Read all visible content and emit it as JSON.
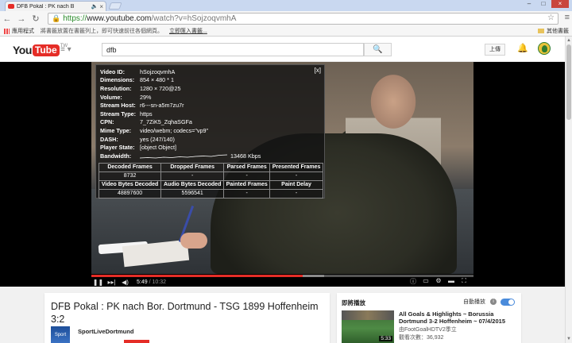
{
  "browser": {
    "tab_title": "DFB Pokal : PK nach B",
    "url_scheme": "https://",
    "url_host": "www.youtube.com",
    "url_path": "/watch?v=hSojzoqvmhA",
    "bookmarks": {
      "apps": "應用程式",
      "hint": "將書籤放置在書籤列上，即可快速前往各個網頁。",
      "import": "立即匯入書籤...",
      "other": "其他書籤"
    }
  },
  "youtube": {
    "logo_you": "You",
    "logo_tube": "Tube",
    "region": "TW",
    "search_value": "dfb",
    "upload_label": "上傳"
  },
  "stats": {
    "rows": [
      {
        "k": "Video ID:",
        "v": "hSojzoqvmhA"
      },
      {
        "k": "Dimensions:",
        "v": "854 × 480 * 1"
      },
      {
        "k": "Resolution:",
        "v": "1280 × 720@25"
      },
      {
        "k": "Volume:",
        "v": "29%"
      },
      {
        "k": "Stream Host:",
        "v": "r6---sn-a5m7zu7r"
      },
      {
        "k": "Stream Type:",
        "v": "https"
      },
      {
        "k": "CPN:",
        "v": "7_7ZiK5_ZqhaSGFa"
      },
      {
        "k": "Mime Type:",
        "v": "video/webm; codecs=\"vp9\""
      },
      {
        "k": "DASH:",
        "v": "yes (247/140)"
      },
      {
        "k": "Player State:",
        "v": "[object Object]"
      }
    ],
    "bandwidth_label": "Bandwidth:",
    "bandwidth_value": "13468 Kbps",
    "table_headers1": [
      "Decoded Frames",
      "Dropped Frames",
      "Parsed Frames",
      "Presented Frames"
    ],
    "table_values1": [
      "8732",
      "-",
      "-",
      "-"
    ],
    "table_headers2": [
      "Video Bytes Decoded",
      "Audio Bytes Decoded",
      "Painted Frames",
      "Paint Delay"
    ],
    "table_values2": [
      "48897600",
      "5596541",
      "-",
      "-"
    ],
    "close_label": "[x]"
  },
  "player": {
    "current_time": "5:49",
    "separator": " / ",
    "total_time": "10:32",
    "progress_played_fraction": 0.553,
    "progress_loaded_fraction": 0.61
  },
  "video": {
    "title": "DFB Pokal : PK nach Bor. Dortmund - TSG 1899 Hoffenheim 3:2",
    "channel": "SportLiveDortmund",
    "channel_icon_text": "Sport"
  },
  "sidebar": {
    "header": "即將播放",
    "autoplay": "自動播放",
    "next_title": "All Goals & Highlights ~ Borussia Dortmund 3-2 Hoffenheim ~ 07/4/2015",
    "next_channel": "由FootGoalHDTV2季立",
    "next_views": "觀看次數：36,932",
    "next_duration": "5:33"
  },
  "colors": {
    "accent": "#e52d27",
    "toggle": "#4a8bdb"
  }
}
